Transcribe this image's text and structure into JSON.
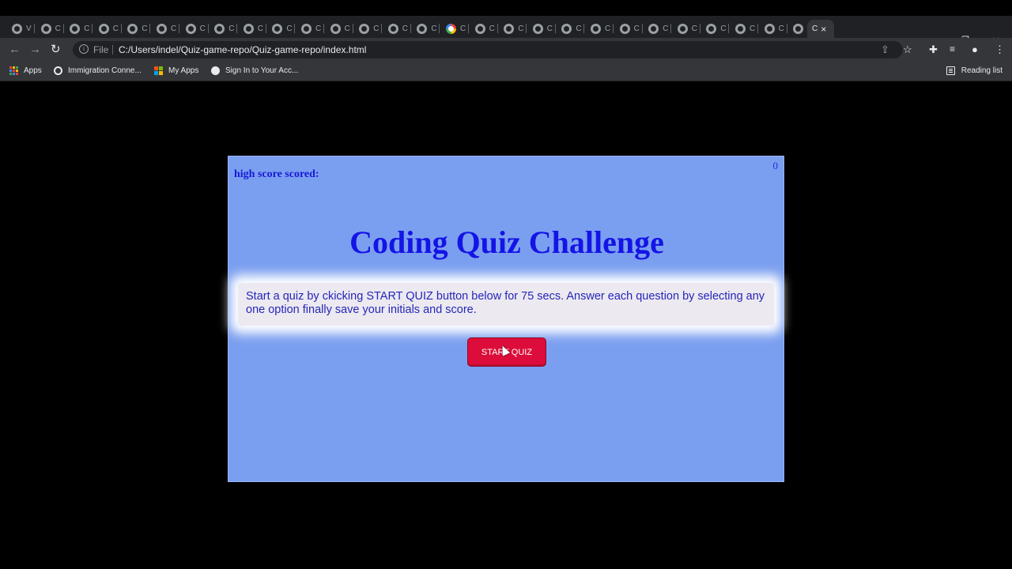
{
  "browser": {
    "tabs": [
      {
        "title": "V",
        "icon": "globe-icon"
      },
      {
        "title": "C",
        "icon": "globe-icon"
      },
      {
        "title": "C",
        "icon": "globe-icon"
      },
      {
        "title": "C",
        "icon": "globe-icon"
      },
      {
        "title": "C",
        "icon": "globe-icon"
      },
      {
        "title": "C",
        "icon": "globe-icon"
      },
      {
        "title": "C",
        "icon": "globe-icon"
      },
      {
        "title": "C",
        "icon": "globe-icon"
      },
      {
        "title": "C",
        "icon": "globe-icon"
      },
      {
        "title": "C",
        "icon": "globe-icon"
      },
      {
        "title": "C",
        "icon": "globe-icon"
      },
      {
        "title": "C",
        "icon": "globe-icon"
      },
      {
        "title": "C",
        "icon": "globe-icon"
      },
      {
        "title": "C",
        "icon": "globe-icon"
      },
      {
        "title": "C",
        "icon": "globe-icon"
      },
      {
        "title": "C",
        "icon": "google-icon"
      },
      {
        "title": "C",
        "icon": "globe-icon"
      },
      {
        "title": "C",
        "icon": "globe-icon"
      },
      {
        "title": "C",
        "icon": "globe-icon"
      },
      {
        "title": "C",
        "icon": "globe-icon"
      },
      {
        "title": "C",
        "icon": "globe-icon"
      },
      {
        "title": "C",
        "icon": "globe-icon"
      },
      {
        "title": "C",
        "icon": "globe-icon"
      },
      {
        "title": "C",
        "icon": "globe-icon"
      },
      {
        "title": "C",
        "icon": "globe-icon"
      },
      {
        "title": "C",
        "icon": "globe-icon"
      },
      {
        "title": "C",
        "icon": "globe-icon"
      },
      {
        "title": "C",
        "icon": "globe-icon"
      }
    ],
    "active_tab": {
      "title": "C",
      "close": "×"
    },
    "new_tab": "+",
    "address": {
      "scheme_label": "File",
      "url": "C:/Users/indel/Quiz-game-repo/Quiz-game-repo/index.html"
    },
    "bookmarks": [
      {
        "label": "Apps",
        "icon": "apps-grid-icon"
      },
      {
        "label": "Immigration Conne...",
        "icon": "ring-icon"
      },
      {
        "label": "My Apps",
        "icon": "microsoft-icon"
      },
      {
        "label": "Sign In to Your Acc...",
        "icon": "globe-icon"
      }
    ],
    "reading_list": "Reading list"
  },
  "page": {
    "high_score_label": "high score scored:",
    "high_score_value": "0",
    "title": "Coding Quiz Challenge",
    "instructions": "Start a quiz by ckicking START QUIZ button below for 75 secs. Answer each question by selecting any one option finally save your initials and score.",
    "start_button": "START QUIZ"
  },
  "colors": {
    "card_bg": "#7b9ff0",
    "title": "#1414e6",
    "button": "#dc0d3a",
    "page_bg": "#000000"
  }
}
